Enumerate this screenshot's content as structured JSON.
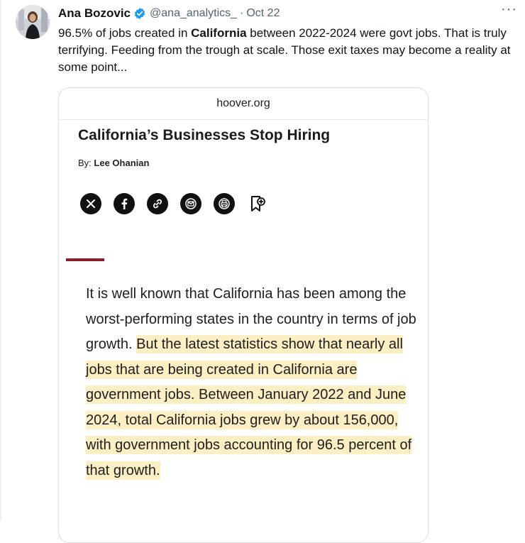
{
  "tweet": {
    "author_name": "Ana Bozovic",
    "handle": "@ana_analytics_",
    "separator": "·",
    "date": "Oct 22",
    "more_label": "···",
    "text_pre": "96.5% of jobs created in ",
    "text_bold": "California",
    "text_post": " between 2022-2024 were govt jobs. That is truly terrifying. Feeding from the trough at scale. Those exit taxes may become a reality at some point..."
  },
  "article": {
    "domain": "hoover.org",
    "title": "California’s Businesses Stop Hiring",
    "byline_prefix": "By: ",
    "author": "Lee Ohanian",
    "share_icons": [
      "x-icon",
      "facebook-icon",
      "link-icon",
      "email-icon",
      "print-icon",
      "bookmark-add-icon"
    ],
    "accent_color": "#8c1d2f",
    "highlight_color": "#fbefc3",
    "body_plain": "It is well known that California has been among the worst-performing states in the country in terms of job growth. ",
    "body_highlight": "But the latest statistics show that nearly all jobs that are being created in California are government jobs. Between January 2022 and June 2024, total California jobs grew by about 156,000, with government jobs accounting for 96.5 percent of that growth."
  }
}
